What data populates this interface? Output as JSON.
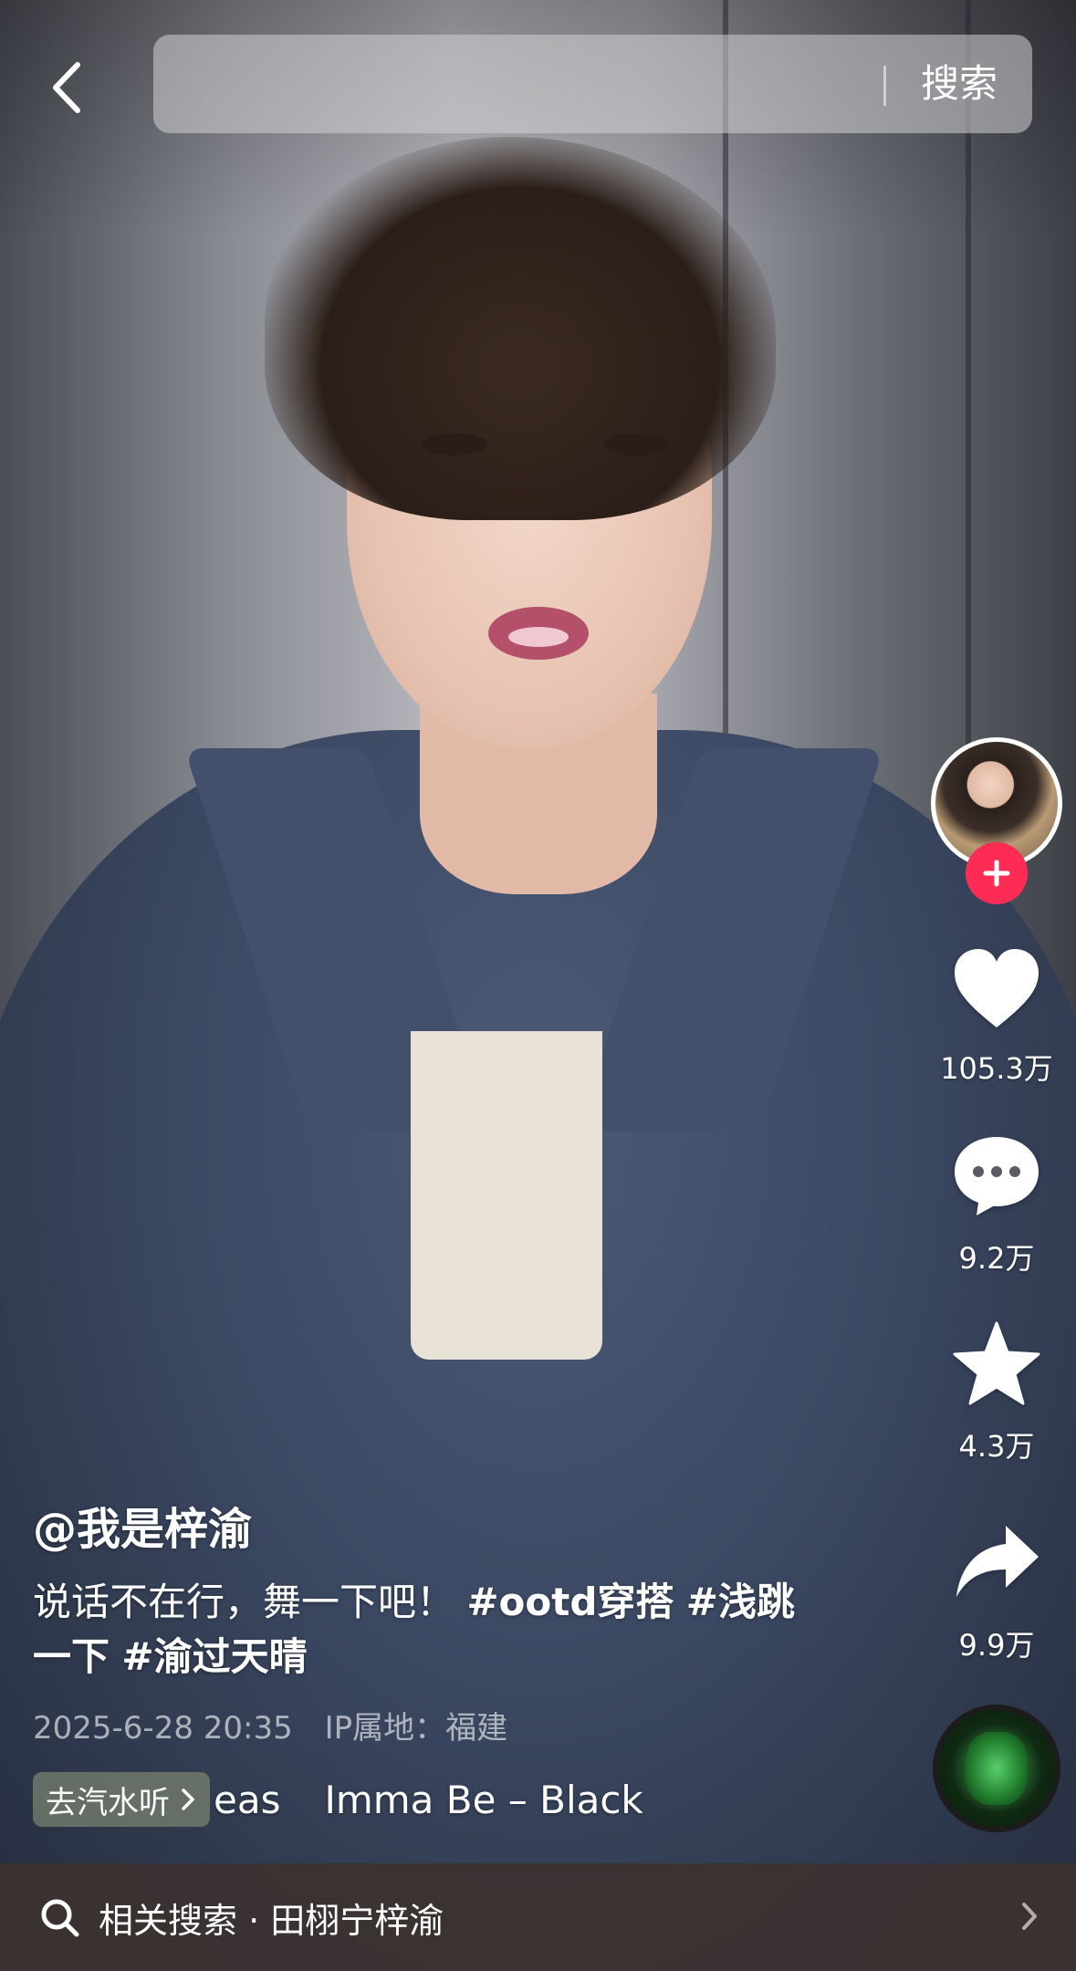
{
  "top_bar": {
    "back_icon": "chevron-left-icon",
    "search_button_label": "搜索"
  },
  "right_rail": {
    "avatar_icon": "author-avatar",
    "follow_icon": "plus-icon",
    "like_count": "105.3万",
    "comment_count": "9.2万",
    "favorite_count": "4.3万",
    "share_count": "9.9万",
    "music_disc_icon": "music-disc-icon"
  },
  "post": {
    "author": "@我是梓渝",
    "caption_text": "说话不在行，舞一下吧！ ",
    "hashtag_1": "#ootd穿搭",
    "hashtag_2": "#浅跳一下",
    "hashtag_3": "#渝过天晴",
    "date": "2025-6-28 20:35",
    "ip_location": "IP属地：福建"
  },
  "music": {
    "soda_button_label": "去汽水听",
    "title_part_1": "eas",
    "title_part_2": "Imma Be – Black"
  },
  "related_search": {
    "label": "相关搜索 · 田栩宁梓渝"
  },
  "colors": {
    "follow_red": "#fe2c55",
    "overlay_bar": "#3c3230"
  }
}
